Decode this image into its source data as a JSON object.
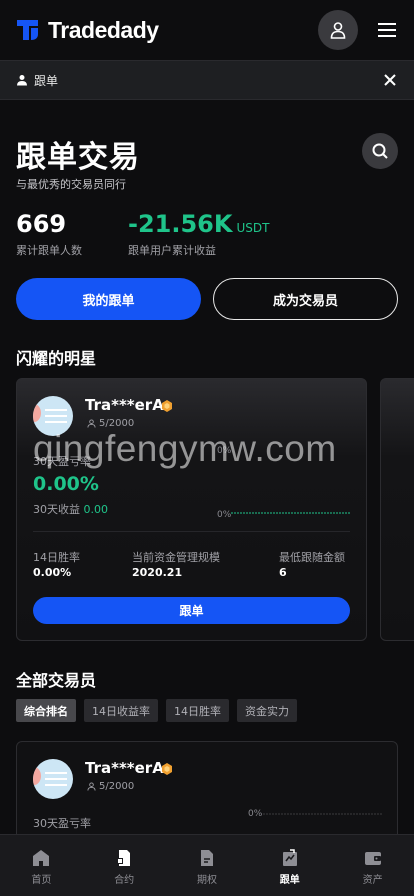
{
  "header": {
    "app_name": "Tradedady"
  },
  "sub_bar": {
    "label": "跟单"
  },
  "page": {
    "title": "跟单交易",
    "subtitle": "与最优秀的交易员同行"
  },
  "stats": {
    "followers": {
      "value": "669",
      "label": "累计跟单人数"
    },
    "profit": {
      "value": "-21.56K",
      "unit": "USDT",
      "label": "跟单用户累计收益"
    }
  },
  "buttons": {
    "my_follow": "我的跟单",
    "become_trader": "成为交易员"
  },
  "stars_section": {
    "title": "闪耀的明星",
    "card": {
      "name": "Tra***erA",
      "followers": "5/2000",
      "roi_label": "30天盈亏率",
      "roi_value": "0.00%",
      "income_label": "30天收益",
      "income_value": "0.00",
      "axis_top": "0%",
      "axis_bottom": "0%",
      "win_rate_label": "14日胜率",
      "win_rate_value": "0.00%",
      "aum_label": "当前资金管理规模",
      "aum_value": "2020.21",
      "min_amount_label": "最低跟随金额",
      "min_amount_value": "6",
      "follow_button": "跟单"
    }
  },
  "all_section": {
    "title": "全部交易员",
    "tabs": [
      "综合排名",
      "14日收益率",
      "14日胜率",
      "资金实力"
    ],
    "active_tab": 0,
    "card": {
      "name": "Tra***erA",
      "followers": "5/2000",
      "roi_label": "30天盈亏率",
      "axis_top": "0%"
    }
  },
  "watermark": "qingfengymw.com",
  "bottom_nav": {
    "items": [
      {
        "label": "首页",
        "icon": "home-icon"
      },
      {
        "label": "合约",
        "icon": "contract-icon"
      },
      {
        "label": "期权",
        "icon": "options-icon"
      },
      {
        "label": "跟单",
        "icon": "copy-trade-icon"
      },
      {
        "label": "资产",
        "icon": "wallet-icon"
      }
    ],
    "active": 3
  },
  "colors": {
    "accent": "#1555f5",
    "positive": "#1fc48a",
    "background": "#0d0d0f"
  }
}
